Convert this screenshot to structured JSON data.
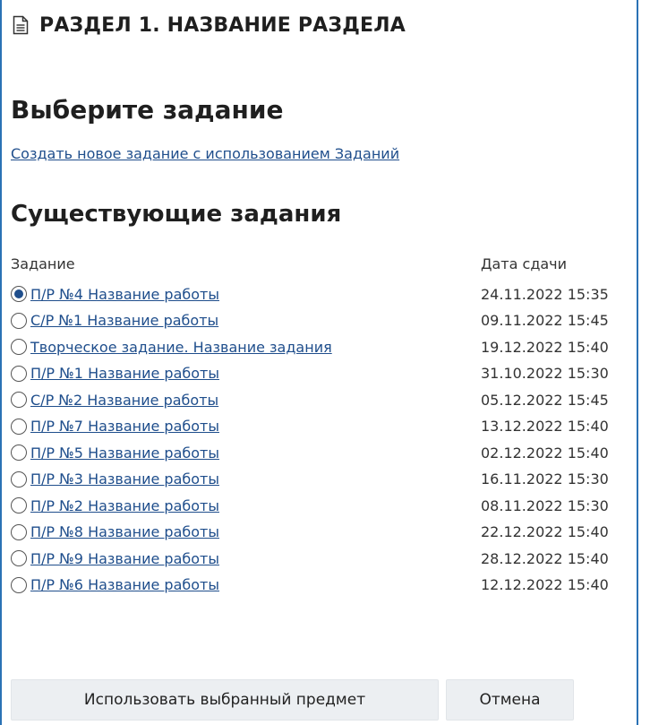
{
  "header": {
    "icon": "document-icon",
    "title": "РАЗДЕЛ 1. НАЗВАНИЕ РАЗДЕЛА"
  },
  "heading": "Выберите задание",
  "create_link": "Создать новое задание с использованием Заданий",
  "existing_heading": "Существующие задания",
  "table": {
    "columns": [
      "Задание",
      "Дата сдачи"
    ],
    "rows": [
      {
        "name": "П/Р №4 Название работы",
        "date": "24.11.2022 15:35",
        "selected": true
      },
      {
        "name": "С/Р №1 Название работы",
        "date": "09.11.2022 15:45",
        "selected": false
      },
      {
        "name": "Творческое задание. Название задания",
        "date": "19.12.2022 15:40",
        "selected": false
      },
      {
        "name": "П/Р №1 Название работы",
        "date": "31.10.2022 15:30",
        "selected": false
      },
      {
        "name": "С/Р №2 Название работы",
        "date": "05.12.2022 15:45",
        "selected": false
      },
      {
        "name": "П/Р №7 Название работы",
        "date": "13.12.2022 15:40",
        "selected": false
      },
      {
        "name": "П/Р №5 Название работы",
        "date": "02.12.2022 15:40",
        "selected": false
      },
      {
        "name": "П/Р №3 Название работы",
        "date": "16.11.2022 15:30",
        "selected": false
      },
      {
        "name": "П/Р №2 Название работы",
        "date": "08.11.2022 15:30",
        "selected": false
      },
      {
        "name": "П/Р №8 Название работы",
        "date": "22.12.2022 15:40",
        "selected": false
      },
      {
        "name": "П/Р №9 Название работы",
        "date": "28.12.2022 15:40",
        "selected": false
      },
      {
        "name": "П/Р №6 Название работы",
        "date": "12.12.2022 15:40",
        "selected": false
      }
    ]
  },
  "buttons": {
    "use_label": "Использовать выбранный предмет",
    "cancel_label": "Отмена"
  },
  "colors": {
    "border": "#2a72b5",
    "link": "#1f4e8c",
    "button_bg": "#eceff2"
  }
}
